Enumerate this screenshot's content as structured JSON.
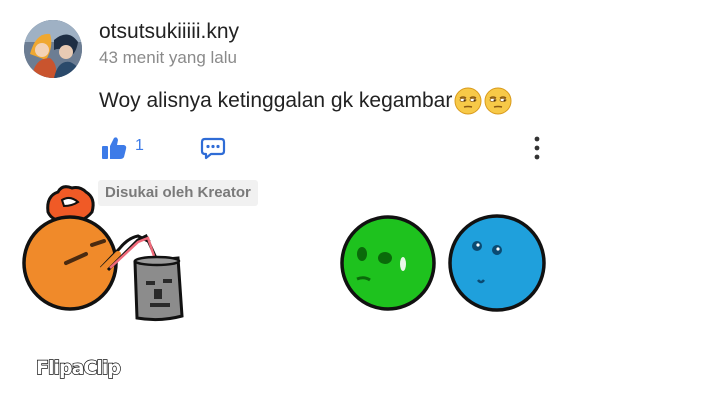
{
  "comment": {
    "username": "otsutsukiiiii.kny",
    "timestamp": "43 menit yang lalu",
    "text": "Woy alisnya ketinggalan gk kegambar",
    "emojis": [
      "unamused-face-icon",
      "unamused-face-icon"
    ],
    "like_count": "1",
    "liked_by_creator_badge": "Disukai oleh Kreator"
  },
  "watermark": "FlipaClip",
  "colors": {
    "like_blue": "#3d7be8",
    "orange_ball": "#f08a2a",
    "green_ball": "#1ec21e",
    "blue_ball": "#1fa0dc"
  }
}
